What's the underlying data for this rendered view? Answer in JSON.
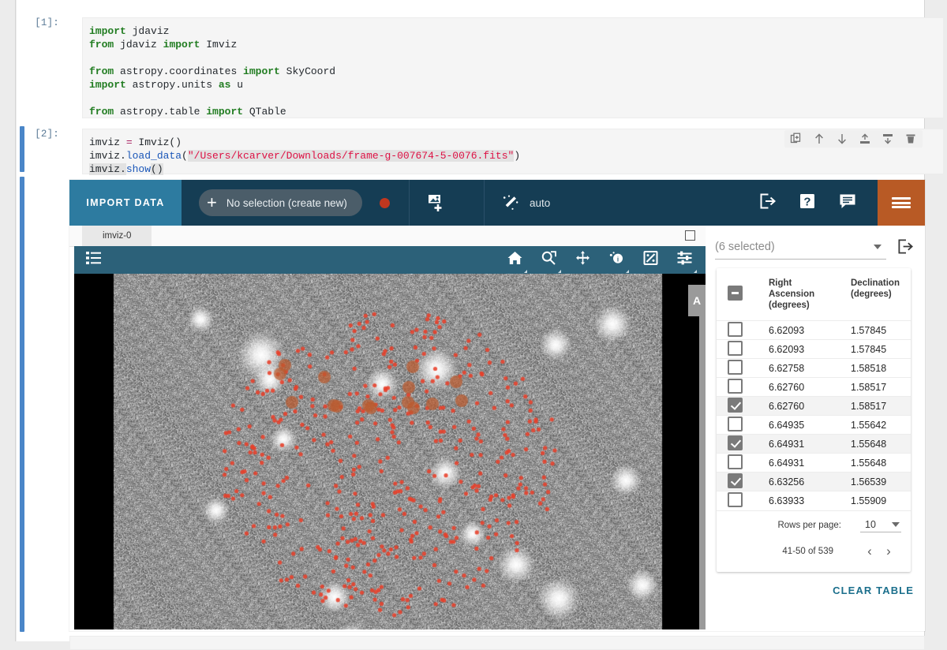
{
  "notebook": {
    "cells": [
      {
        "prompt": "[1]:",
        "lines": [
          [
            {
              "t": "import",
              "c": "kw"
            },
            {
              "t": " jdaviz",
              "c": "plain"
            }
          ],
          [
            {
              "t": "from",
              "c": "kw"
            },
            {
              "t": " jdaviz ",
              "c": "plain"
            },
            {
              "t": "import",
              "c": "kw"
            },
            {
              "t": " Imviz",
              "c": "plain"
            }
          ],
          [],
          [
            {
              "t": "from",
              "c": "kw"
            },
            {
              "t": " astropy.coordinates ",
              "c": "plain"
            },
            {
              "t": "import",
              "c": "kw"
            },
            {
              "t": " SkyCoord",
              "c": "plain"
            }
          ],
          [
            {
              "t": "import",
              "c": "kw"
            },
            {
              "t": " astropy.units ",
              "c": "plain"
            },
            {
              "t": "as",
              "c": "kw"
            },
            {
              "t": " u",
              "c": "plain"
            }
          ],
          [],
          [
            {
              "t": "from",
              "c": "kw"
            },
            {
              "t": " astropy.table ",
              "c": "plain"
            },
            {
              "t": "import",
              "c": "kw"
            },
            {
              "t": " QTable",
              "c": "plain"
            }
          ]
        ]
      },
      {
        "prompt": "[2]:",
        "lines": [
          [
            {
              "t": "imviz ",
              "c": "plain"
            },
            {
              "t": "=",
              "c": "op"
            },
            {
              "t": " Imviz()",
              "c": "plain"
            }
          ],
          [
            {
              "t": "imviz.",
              "c": "plain"
            },
            {
              "t": "load_data",
              "c": "fn"
            },
            {
              "t": "(",
              "c": "plain"
            },
            {
              "t": "\"/Users/kcarver/Downloads/frame-g-007674-5-0076.fits\"",
              "c": "str"
            },
            {
              "t": ")",
              "c": "plain"
            }
          ],
          [
            {
              "t": "imviz.",
              "c": "hl"
            },
            {
              "t": "show",
              "c": "fn"
            },
            {
              "t": "()",
              "c": "hl"
            }
          ]
        ]
      }
    ],
    "cell_toolbar": [
      {
        "name": "duplicate-cell-icon",
        "title": "Duplicate cell"
      },
      {
        "name": "move-cell-up-icon",
        "title": "Move cell up"
      },
      {
        "name": "move-cell-down-icon",
        "title": "Move cell down"
      },
      {
        "name": "insert-cell-above-icon",
        "title": "Insert cell above"
      },
      {
        "name": "insert-cell-below-icon",
        "title": "Insert cell below"
      },
      {
        "name": "delete-cell-icon",
        "title": "Delete cell"
      }
    ]
  },
  "app": {
    "colors": {
      "toolbar_bg": "#153d54",
      "import_btn_bg": "#2d7ba0",
      "viewer_toolbar_bg": "#2c6179",
      "menu_bg": "#b85a25",
      "record_dot": "#c0371f",
      "marker": "#e8402a",
      "accent_link": "#1b6f8c"
    },
    "toolbar": {
      "import_label": "IMPORT DATA",
      "selection_label": "No selection (create new)",
      "plus_glyph": "+",
      "stretch_label": "auto",
      "icons": [
        {
          "name": "add-image-viewer-icon"
        },
        {
          "name": "magic-wand-autostretch-icon"
        },
        {
          "name": "export-icon"
        },
        {
          "name": "help-icon"
        },
        {
          "name": "feedback-icon"
        },
        {
          "name": "menu-hamburger-icon"
        }
      ]
    },
    "viewer": {
      "tab_label": "imviz-0",
      "layer_tab_label": "A",
      "tools": [
        {
          "name": "home-reset-zoom-icon"
        },
        {
          "name": "zoom-box-icon"
        },
        {
          "name": "pan-icon"
        },
        {
          "name": "subset-info-icon"
        },
        {
          "name": "contrast-bias-icon"
        },
        {
          "name": "viewer-settings-icon"
        }
      ],
      "sidebar_icon": "data-layers-list-icon"
    },
    "table": {
      "select_value": "(6 selected)",
      "export_icon": "export-table-icon",
      "columns": [
        "Right Ascension (degrees)",
        "Declination (degrees)"
      ],
      "column_lines": [
        [
          "Right",
          "Ascension",
          "(degrees)"
        ],
        [
          "Declination",
          "(degrees)"
        ]
      ],
      "header_checkbox_state": "indeterminate",
      "rows": [
        {
          "checked": false,
          "ra": "6.62093",
          "dec": "1.57845"
        },
        {
          "checked": false,
          "ra": "6.62093",
          "dec": "1.57845"
        },
        {
          "checked": false,
          "ra": "6.62758",
          "dec": "1.58518"
        },
        {
          "checked": false,
          "ra": "6.62760",
          "dec": "1.58517"
        },
        {
          "checked": true,
          "ra": "6.62760",
          "dec": "1.58517"
        },
        {
          "checked": false,
          "ra": "6.64935",
          "dec": "1.55642"
        },
        {
          "checked": true,
          "ra": "6.64931",
          "dec": "1.55648"
        },
        {
          "checked": false,
          "ra": "6.64931",
          "dec": "1.55648"
        },
        {
          "checked": true,
          "ra": "6.63256",
          "dec": "1.56539"
        },
        {
          "checked": false,
          "ra": "6.63933",
          "dec": "1.55909"
        }
      ],
      "rows_per_page_label": "Rows per page:",
      "rows_per_page_value": "10",
      "page_range": "41-50 of 539",
      "prev_glyph": "‹",
      "next_glyph": "›",
      "clear_label": "CLEAR TABLE"
    }
  }
}
